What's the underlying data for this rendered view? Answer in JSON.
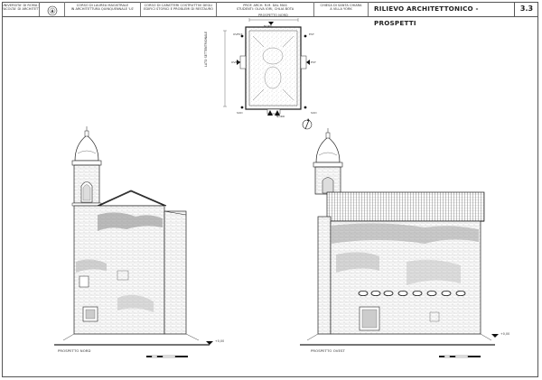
{
  "title_block": {
    "university": [
      "UNIVERSITA' DI ROMA LA SAPIENZA",
      "FACOLTA' DI ARCHITETTURA"
    ],
    "degree": [
      "CORSO DI LAUREA MAGISTRALE",
      "IN ARCHITETTURA QUINQUENNALE 'LS'"
    ],
    "course": [
      "CORSO DI CARATTERI COSTRUTTIVI DEGLI",
      "EDIFICI STORICI E PROBLEMI DI RESTAURO"
    ],
    "people": [
      "PROF. ARCH. R.M. DAL MAS",
      "STUDENTI: OLIVA IORI, CHLIA BOTA"
    ],
    "subject": [
      "CHIESA DI SANTA CHIARA",
      "A VILLA YORK"
    ],
    "sheet_title": "RILIEVO ARCHITETTONICO - PROSPETTI",
    "sheet_number": "3.3"
  },
  "plan": {
    "top_label": "PROSPETTO NORD",
    "side_label": "LATO SETTENTRIONALE",
    "markers": [
      "NORD",
      "NORD",
      "OVEST",
      "EST",
      "SUD",
      "SUD",
      "EST",
      "OVEST"
    ]
  },
  "elevations": {
    "left_caption": "PROSPETTO NORD",
    "right_caption": "PROSPETTO OVEST",
    "left_level": "+0,00",
    "right_level": "+0,00"
  }
}
